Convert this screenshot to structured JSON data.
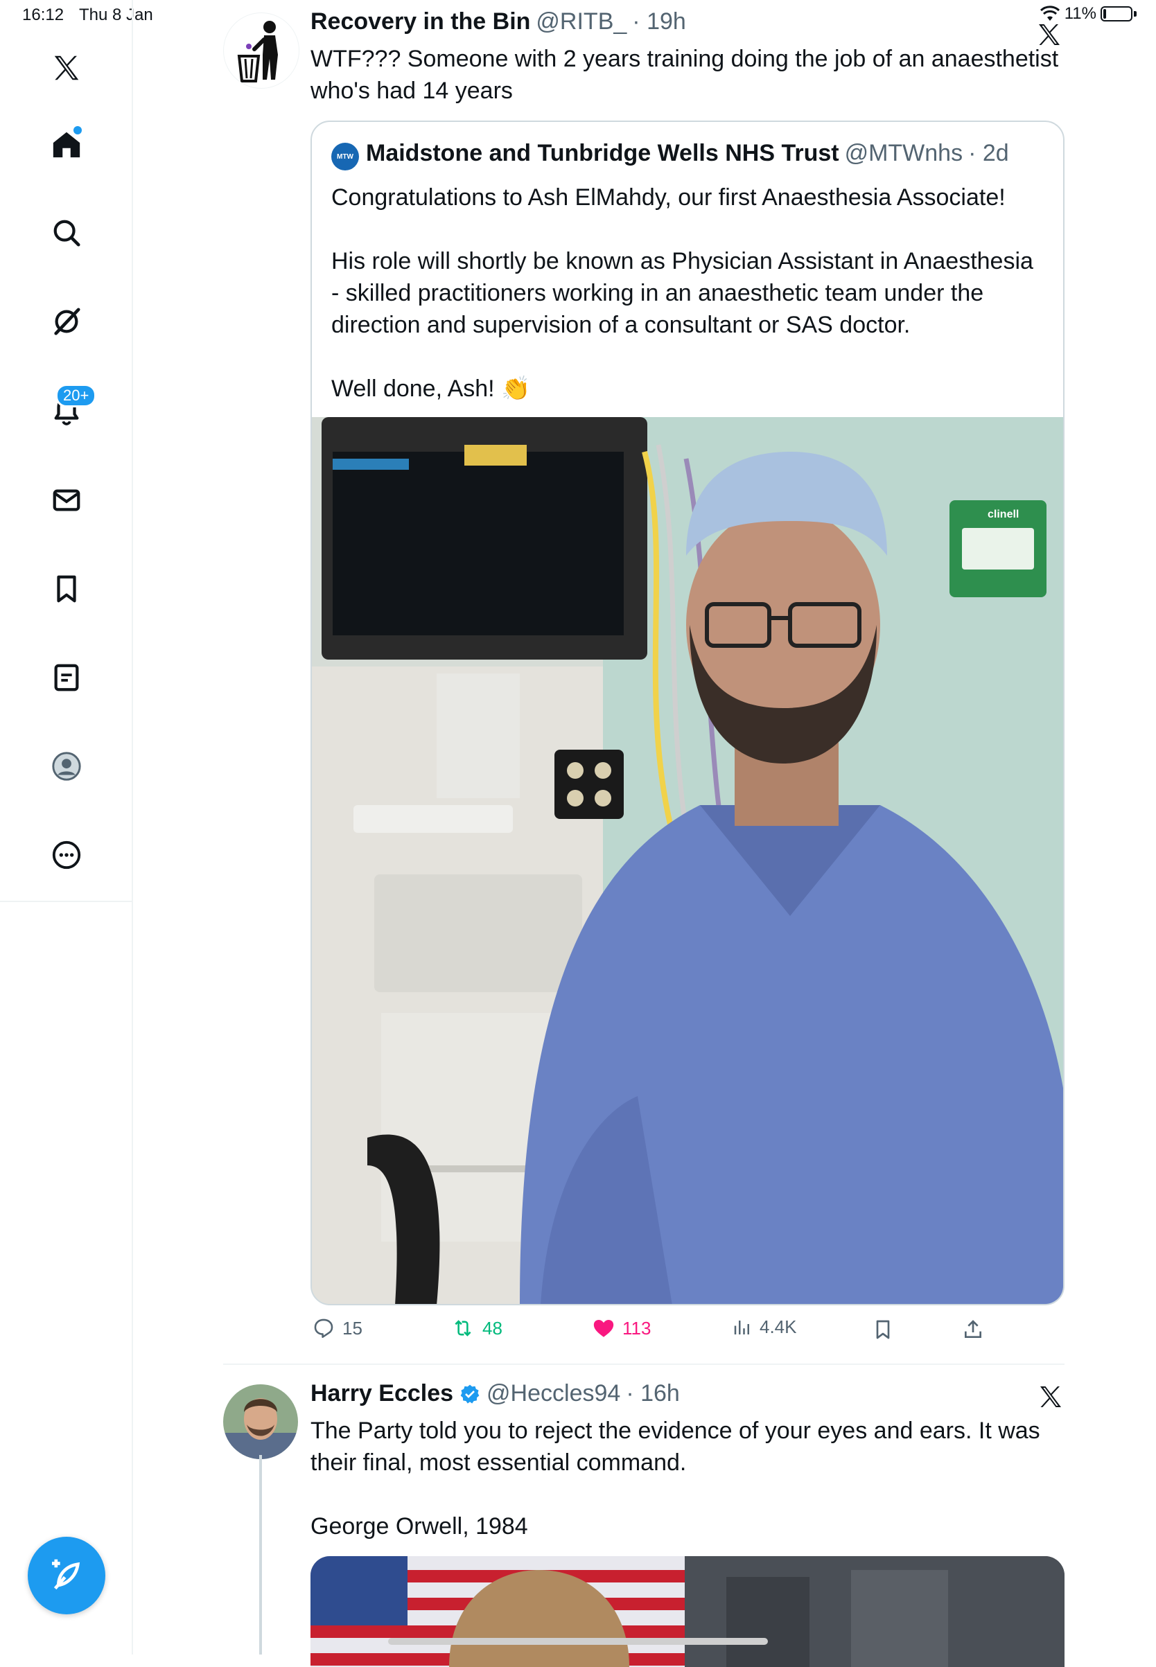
{
  "status": {
    "time": "16:12",
    "date": "Thu 8 Jan",
    "battery": "11%"
  },
  "nav": {
    "items": [
      {
        "name": "x-logo-icon"
      },
      {
        "name": "home-icon"
      },
      {
        "name": "search-icon"
      },
      {
        "name": "grok-icon"
      },
      {
        "name": "notifications-icon",
        "badge": "20+"
      },
      {
        "name": "messages-icon"
      },
      {
        "name": "bookmarks-icon"
      },
      {
        "name": "lists-icon"
      },
      {
        "name": "profile-icon"
      },
      {
        "name": "more-icon"
      }
    ],
    "accent": "#1d9bf0"
  },
  "tweet1": {
    "author": "Recovery in the Bin",
    "handle": "@RITB_",
    "time": "· 19h",
    "text_lines": [
      "WTF??? Someone with 2 years training doing the job of an anaesthetist",
      "who's had 14 years"
    ],
    "quote": {
      "avatar_label": "MTW",
      "author": "Maidstone and Tunbridge Wells NHS Trust",
      "handle": "@MTWnhs",
      "time": "· 2d",
      "line1": "Congratulations to Ash ElMahdy, our first Anaesthesia Associate!",
      "para2": [
        "His role will shortly be known as Physician Assistant in Anaesthesia",
        "- skilled practitioners working in an anaesthetic team under the",
        "direction and supervision of a consultant or SAS doctor."
      ],
      "line3": "Well done, Ash! 👏",
      "photo_label": "clinell"
    },
    "actions": {
      "replies": "15",
      "reposts": "48",
      "likes": "113",
      "views": "4.4K"
    },
    "colors": {
      "repost": "#00ba7c",
      "like": "#f91880"
    }
  },
  "tweet2": {
    "author": "Harry Eccles",
    "handle": "@Heccles94",
    "time": "· 16h",
    "text_lines": [
      "The Party told you to reject the evidence of your eyes and ears. It was",
      "their final, most essential command."
    ],
    "line2": "George Orwell, 1984"
  }
}
